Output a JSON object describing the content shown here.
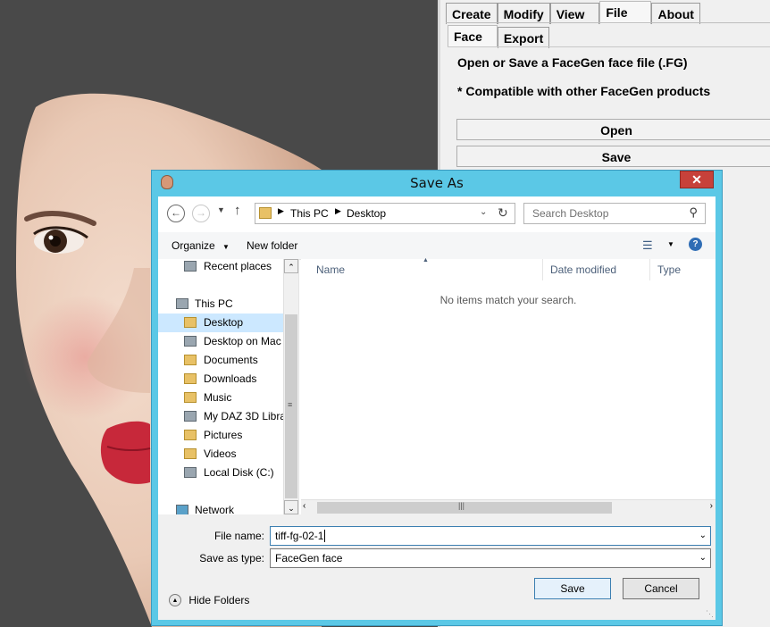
{
  "panel": {
    "tabs_top": [
      "Create",
      "Modify",
      "View",
      "File",
      "About"
    ],
    "tabs_sub": [
      "Face",
      "Export"
    ],
    "line1": "Open or Save a FaceGen face file (.FG)",
    "line2": "* Compatible with other FaceGen products",
    "open_label": "Open",
    "save_label": "Save"
  },
  "dialog": {
    "title": "Save As",
    "close_glyph": "✕",
    "address": {
      "root": "This PC",
      "current": "Desktop"
    },
    "search_placeholder": "Search Desktop",
    "organize_label": "Organize",
    "new_folder_label": "New folder",
    "nav_items": [
      {
        "label": "Recent places",
        "icon": "recent-places-icon"
      },
      {
        "label": "This PC",
        "icon": "computer-icon"
      },
      {
        "label": "Desktop",
        "icon": "folder-icon"
      },
      {
        "label": "Desktop on Mac",
        "icon": "network-drive-icon"
      },
      {
        "label": "Documents",
        "icon": "folder-icon"
      },
      {
        "label": "Downloads",
        "icon": "folder-icon"
      },
      {
        "label": "Music",
        "icon": "folder-icon"
      },
      {
        "label": "My DAZ 3D Libra",
        "icon": "network-drive-icon"
      },
      {
        "label": "Pictures",
        "icon": "folder-icon"
      },
      {
        "label": "Videos",
        "icon": "folder-icon"
      },
      {
        "label": "Local Disk (C:)",
        "icon": "drive-icon"
      },
      {
        "label": "Network",
        "icon": "network-icon"
      }
    ],
    "columns": [
      "Name",
      "Date modified",
      "Type"
    ],
    "empty_message": "No items match your search.",
    "file_name_label": "File name:",
    "file_name_value": "tiff-fg-02-1",
    "save_type_label": "Save as type:",
    "save_type_value": "FaceGen face",
    "hide_folders_label": "Hide Folders",
    "save_button": "Save",
    "cancel_button": "Cancel",
    "selected_nav": "Desktop"
  },
  "colors": {
    "titlebar": "#5bc8e6",
    "close": "#c7413a",
    "selection": "#cce8ff"
  }
}
